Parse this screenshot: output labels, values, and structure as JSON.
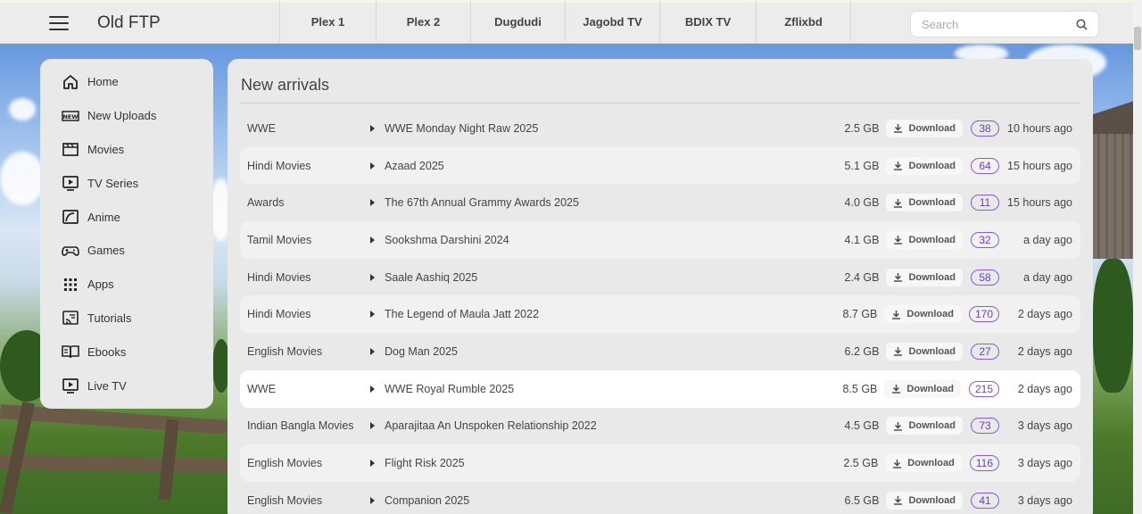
{
  "brand": "Old FTP",
  "nav_tabs": [
    {
      "label": "Plex 1"
    },
    {
      "label": "Plex 2"
    },
    {
      "label": "Dugdudi"
    },
    {
      "label": "Jagobd TV"
    },
    {
      "label": "BDIX TV"
    },
    {
      "label": "Zflixbd"
    }
  ],
  "search": {
    "placeholder": "Search",
    "icon": "search-icon"
  },
  "sidebar": {
    "items": [
      {
        "label": "Home",
        "icon": "home-icon"
      },
      {
        "label": "New Uploads",
        "icon": "new-badge-icon"
      },
      {
        "label": "Movies",
        "icon": "clapperboard-icon"
      },
      {
        "label": "TV Series",
        "icon": "tv-play-icon"
      },
      {
        "label": "Anime",
        "icon": "anime-icon"
      },
      {
        "label": "Games",
        "icon": "gamepad-icon"
      },
      {
        "label": "Apps",
        "icon": "grid-icon"
      },
      {
        "label": "Tutorials",
        "icon": "cast-icon"
      },
      {
        "label": "Ebooks",
        "icon": "book-icon"
      },
      {
        "label": "Live TV",
        "icon": "live-tv-icon"
      }
    ]
  },
  "main": {
    "title": "New arrivals",
    "download_label": "Download",
    "rows": [
      {
        "category": "WWE",
        "title": "WWE Monday Night Raw 2025",
        "size": "2.5 GB",
        "count": "38",
        "time": "10 hours ago"
      },
      {
        "category": "Hindi Movies",
        "title": "Azaad 2025",
        "size": "5.1 GB",
        "count": "64",
        "time": "15 hours ago"
      },
      {
        "category": "Awards",
        "title": "The 67th Annual Grammy Awards 2025",
        "size": "4.0 GB",
        "count": "11",
        "time": "15 hours ago"
      },
      {
        "category": "Tamil Movies",
        "title": "Sookshma Darshini 2024",
        "size": "4.1 GB",
        "count": "32",
        "time": "a day ago"
      },
      {
        "category": "Hindi Movies",
        "title": "Saale Aashiq 2025",
        "size": "2.4 GB",
        "count": "58",
        "time": "a day ago"
      },
      {
        "category": "Hindi Movies",
        "title": "The Legend of Maula Jatt 2022",
        "size": "8.7 GB",
        "count": "170",
        "time": "2 days ago"
      },
      {
        "category": "English Movies",
        "title": "Dog Man 2025",
        "size": "6.2 GB",
        "count": "27",
        "time": "2 days ago"
      },
      {
        "category": "WWE",
        "title": "WWE Royal Rumble 2025",
        "size": "8.5 GB",
        "count": "215",
        "time": "2 days ago"
      },
      {
        "category": "Indian Bangla Movies",
        "title": "Aparajitaa An Unspoken Relationship 2022",
        "size": "4.5 GB",
        "count": "73",
        "time": "3 days ago"
      },
      {
        "category": "English Movies",
        "title": "Flight Risk 2025",
        "size": "2.5 GB",
        "count": "116",
        "time": "3 days ago"
      },
      {
        "category": "English Movies",
        "title": "Companion 2025",
        "size": "6.5 GB",
        "count": "41",
        "time": "3 days ago"
      }
    ]
  },
  "colors": {
    "accent": "#6b3fc2",
    "panel": "#e9e9e9",
    "topbar": "#ececec"
  }
}
